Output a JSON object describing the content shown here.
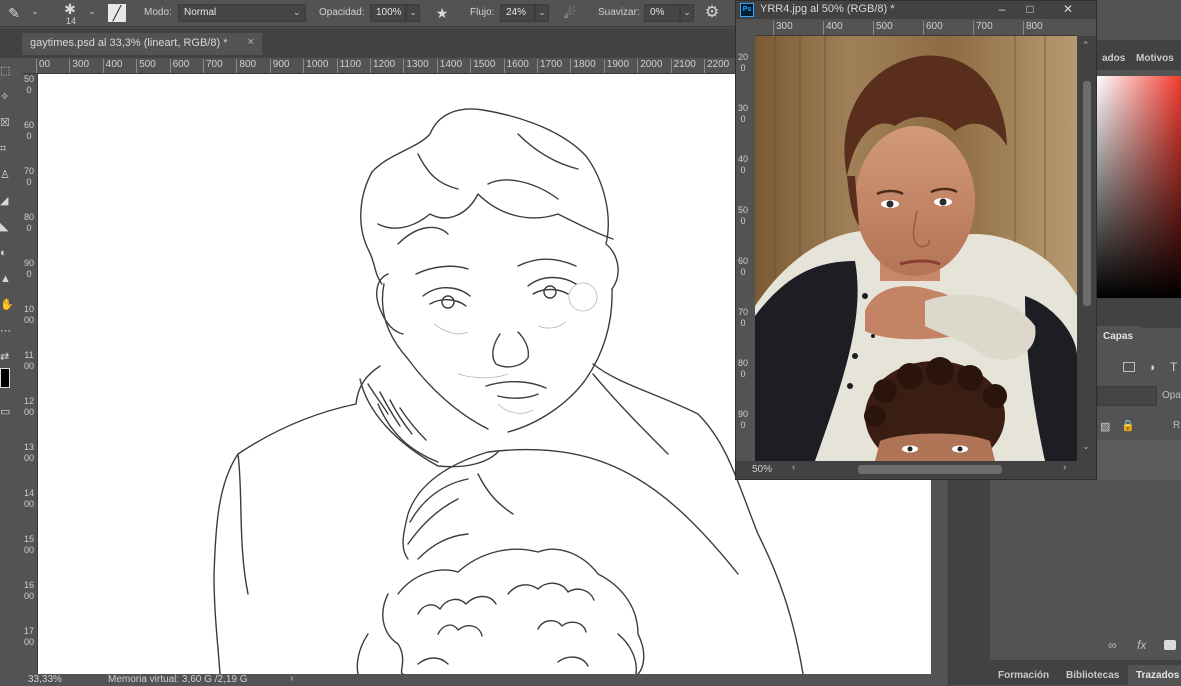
{
  "options_bar": {
    "brush_size": "14",
    "mode_label": "Modo:",
    "mode_value": "Normal",
    "opacity_label": "Opacidad:",
    "opacity_value": "100%",
    "flow_label": "Flujo:",
    "flow_value": "24%",
    "smoothing_label": "Suavizar:",
    "smoothing_value": "0%"
  },
  "document": {
    "tab_title": "gaytimes.psd al 33,3% (lineart, RGB/8) *",
    "close_glyph": "×",
    "zoom": "33,33%",
    "memory": "Memoria virtual: 3,60 G /2,19 G"
  },
  "ruler_top": [
    "00",
    "300",
    "400",
    "500",
    "600",
    "700",
    "800",
    "900",
    "1000",
    "1100",
    "1200",
    "1300",
    "1400",
    "1500",
    "1600",
    "1700",
    "1800",
    "1900",
    "2000",
    "2100",
    "2200"
  ],
  "ruler_left": [
    "500",
    "600",
    "700",
    "800",
    "900",
    "1000",
    "1100",
    "1200",
    "1300",
    "1400",
    "1500",
    "1600",
    "1700"
  ],
  "float_window": {
    "title": "YRR4.jpg al 50% (RGB/8) *",
    "ps_logo": "Ps",
    "zoom": "50%",
    "ruler_top": [
      "300",
      "400",
      "500",
      "600",
      "700",
      "800"
    ],
    "ruler_left": [
      "200",
      "300",
      "400",
      "500",
      "600",
      "700",
      "800",
      "900"
    ]
  },
  "panels": {
    "tab_trazados_partial": "ados",
    "tab_motivos": "Motivos",
    "tab_capas": "Capas",
    "opacity_partial": "Opa",
    "fill_partial": "R",
    "bottom_tabs": [
      "Formación",
      "Bibliotecas",
      "Trazados"
    ]
  },
  "colors": {
    "app_bg": "#535353",
    "dark_bg": "#424242",
    "canvas": "#ffffff",
    "accent_red": "#f33a2e"
  },
  "icons": [
    "brush-icon",
    "brush-preset-icon",
    "toggle-panel-icon",
    "airbrush-icon",
    "pressure-icon",
    "settings-gear-icon"
  ]
}
